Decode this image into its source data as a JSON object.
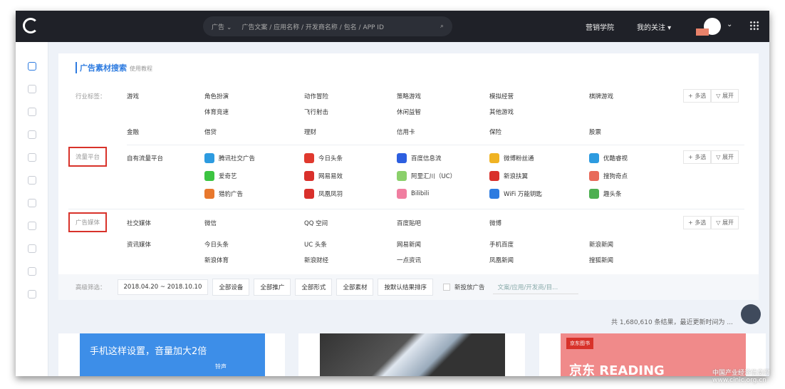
{
  "topbar": {
    "search_type": "广告",
    "search_placeholder": "广告文案 / 应用名称 / 开发商名称 / 包名 / APP ID",
    "nav_academy": "营销学院",
    "nav_follow": "我的关注 ▾"
  },
  "panel": {
    "title": "广告素材搜索",
    "help": "使用教程",
    "industry": {
      "label": "行业标签：",
      "groups": [
        {
          "name": "游戏",
          "items": [
            "角色扮演",
            "动作冒险",
            "策略游戏",
            "模拟经营",
            "棋牌游戏",
            "体育竞速",
            "飞行射击",
            "休闲益智",
            "其他游戏"
          ]
        },
        {
          "name": "金融",
          "items": [
            "借贷",
            "理财",
            "信用卡",
            "保险",
            "股票"
          ]
        }
      ]
    },
    "traffic": {
      "label": "流量平台",
      "group": "自有流量平台",
      "items": [
        {
          "name": "腾讯社交广告",
          "color": "#2d9be0"
        },
        {
          "name": "今日头条",
          "color": "#e0392e"
        },
        {
          "name": "百度信息流",
          "color": "#2d5fe0"
        },
        {
          "name": "微博粉丝通",
          "color": "#f0b323"
        },
        {
          "name": "优酷睿视",
          "color": "#2d9be0"
        },
        {
          "name": "爱奇艺",
          "color": "#3cc441"
        },
        {
          "name": "网易易效",
          "color": "#d9302b"
        },
        {
          "name": "阿里汇川（UC）",
          "color": "#8bd06b"
        },
        {
          "name": "新浪扶翼",
          "color": "#d9302b"
        },
        {
          "name": "搜狗奇点",
          "color": "#e86a5a"
        },
        {
          "name": "猎豹广告",
          "color": "#e8782d"
        },
        {
          "name": "凤凰凤羽",
          "color": "#d9302b"
        },
        {
          "name": "Bilibili",
          "color": "#f07ea0"
        },
        {
          "name": "WiFi 万能钥匙",
          "color": "#2d7be0"
        },
        {
          "name": "趣头条",
          "color": "#4caf50"
        }
      ]
    },
    "media": {
      "label": "广告媒体",
      "groups": [
        {
          "name": "社交媒体",
          "items": [
            "微信",
            "QQ 空间",
            "百度贴吧",
            "微博"
          ]
        },
        {
          "name": "资讯媒体",
          "items": [
            "今日头条",
            "UC 头条",
            "网易新闻",
            "手机百度",
            "新浪新闻",
            "新浪体育",
            "新浪财经",
            "一点资讯",
            "凤凰新闻",
            "搜狐新闻"
          ]
        }
      ]
    },
    "multi_label": "+ 多选",
    "expand_label": "▽ 展开"
  },
  "filter": {
    "label": "高级筛选：",
    "date": "2018.04.20 ~ 2018.10.10",
    "device": "全部设备",
    "promo": "全部推广",
    "form": "全部形式",
    "material": "全部素材",
    "sort": "按默认结果排序",
    "new_ads": "新投放广告",
    "search_placeholder": "文案/应用/开发商/目..."
  },
  "results": {
    "count_text": "共 1,680,610 条结果，最近更新时间为 ..."
  },
  "cards": [
    {
      "text": "手机这样设置，音量加大2倍",
      "sub": "铃声"
    },
    {
      "text": ""
    },
    {
      "text": "京东 READING",
      "sub": "京东图书"
    }
  ],
  "watermark": "中国产业经济信息网 www.cinic.org.cn"
}
